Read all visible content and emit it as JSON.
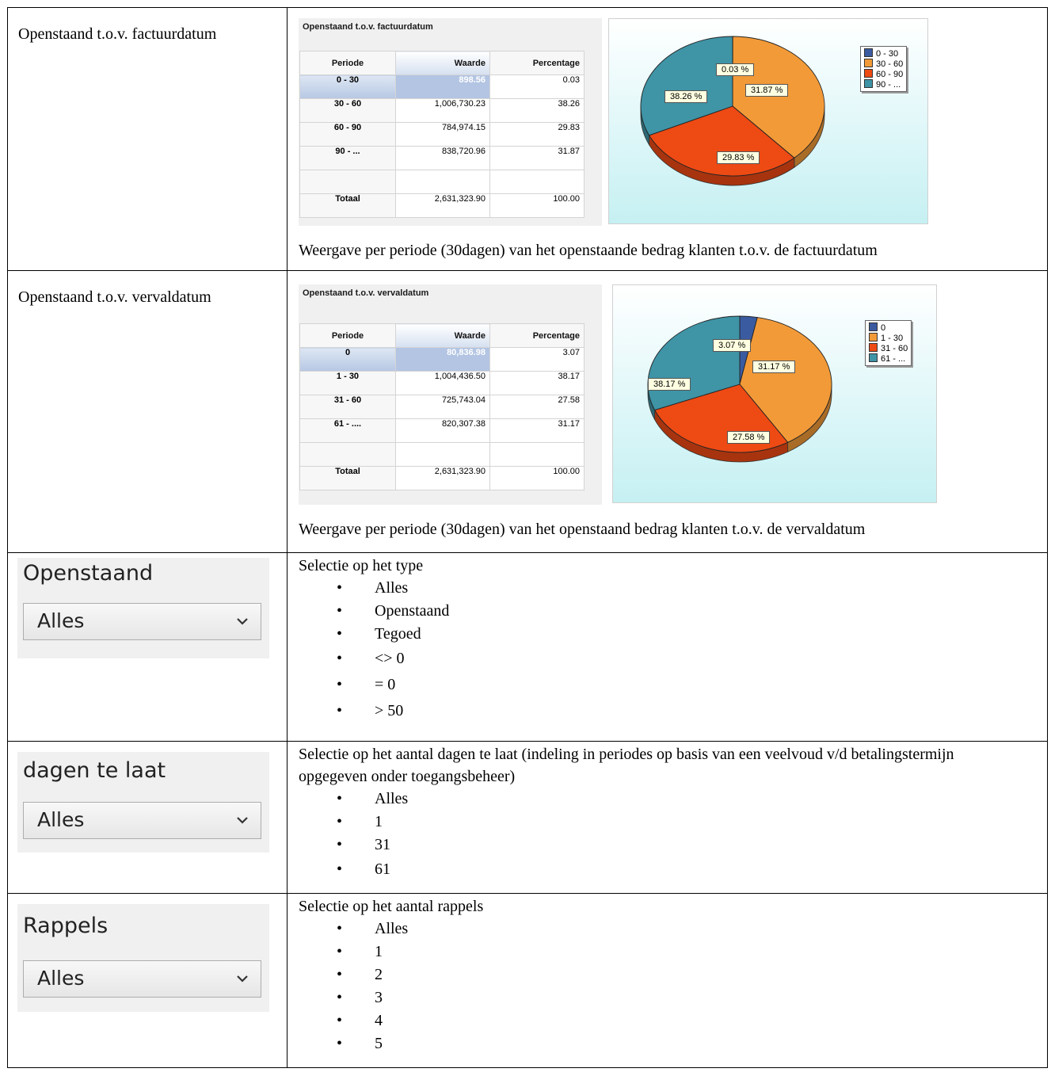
{
  "rows": [
    {
      "label": "Openstaand t.o.v. factuurdatum",
      "panel": {
        "title": "Openstaand t.o.v. factuurdatum",
        "headers": [
          "Periode",
          "Waarde",
          "Percentage"
        ],
        "table": [
          [
            "0 - 30",
            "898.56",
            "0.03"
          ],
          [
            "30 - 60",
            "1,006,730.23",
            "38.26"
          ],
          [
            "60 - 90",
            "784,974.15",
            "29.83"
          ],
          [
            "90 - ...",
            "838,720.96",
            "31.87"
          ],
          [
            "",
            "",
            ""
          ],
          [
            "Totaal",
            "2,631,323.90",
            "100.00"
          ]
        ],
        "legend": [
          "0 - 30",
          "30 - 60",
          "60 - 90",
          "90 - ..."
        ],
        "slice_labels": [
          "0.03 %",
          "38.26 %",
          "29.83 %",
          "31.87 %"
        ]
      },
      "description": "Weergave per periode (30dagen) van het openstaande bedrag klanten t.o.v. de factuurdatum"
    },
    {
      "label": "Openstaand t.o.v. vervaldatum",
      "panel": {
        "title": "Openstaand t.o.v. vervaldatum",
        "headers": [
          "Periode",
          "Waarde",
          "Percentage"
        ],
        "table": [
          [
            "0",
            "80,836.98",
            "3.07"
          ],
          [
            "1 - 30",
            "1,004,436.50",
            "38.17"
          ],
          [
            "31 - 60",
            "725,743.04",
            "27.58"
          ],
          [
            "61 - ....",
            "820,307.38",
            "31.17"
          ],
          [
            "",
            "",
            ""
          ],
          [
            "Totaal",
            "2,631,323.90",
            "100.00"
          ]
        ],
        "legend": [
          "0",
          "1 - 30",
          "31 - 60",
          "61 - ..."
        ],
        "slice_labels": [
          "3.07 %",
          "38.17 %",
          "27.58 %",
          "31.17 %"
        ]
      },
      "description": "Weergave per periode (30dagen) van het openstaand bedrag klanten t.o.v. de vervaldatum"
    }
  ],
  "chart_data": [
    {
      "type": "pie",
      "title": "Openstaand t.o.v. factuurdatum",
      "categories": [
        "0 - 30",
        "30 - 60",
        "60 - 90",
        "90 - ..."
      ],
      "values": [
        0.03,
        38.26,
        29.83,
        31.87
      ],
      "colors": [
        "#3a5ba0",
        "#f29a38",
        "#ee4a14",
        "#3f94a6"
      ],
      "legend_position": "top-right"
    },
    {
      "type": "pie",
      "title": "Openstaand t.o.v. vervaldatum",
      "categories": [
        "0",
        "1 - 30",
        "31 - 60",
        "61 - ..."
      ],
      "values": [
        3.07,
        38.17,
        27.58,
        31.17
      ],
      "colors": [
        "#3a5ba0",
        "#f29a38",
        "#ee4a14",
        "#3f94a6"
      ],
      "legend_position": "top-right"
    }
  ],
  "filters": [
    {
      "widget_label": "Openstaand",
      "value": "Alles",
      "description": "Selectie op het type",
      "options": [
        "Alles",
        "Openstaand",
        "Tegoed",
        "<> 0",
        "= 0",
        "> 50"
      ]
    },
    {
      "widget_label": "dagen te laat",
      "value": "Alles",
      "description": "Selectie op het aantal dagen te laat (indeling in periodes op basis van een veelvoud v/d betalingstermijn opgegeven onder toegangsbeheer)",
      "options": [
        "Alles",
        "1",
        "31",
        "61"
      ]
    },
    {
      "widget_label": "Rappels",
      "value": "Alles",
      "description": "Selectie op het aantal rappels",
      "options": [
        "Alles",
        "1",
        "2",
        "3",
        "4",
        "5"
      ]
    }
  ]
}
